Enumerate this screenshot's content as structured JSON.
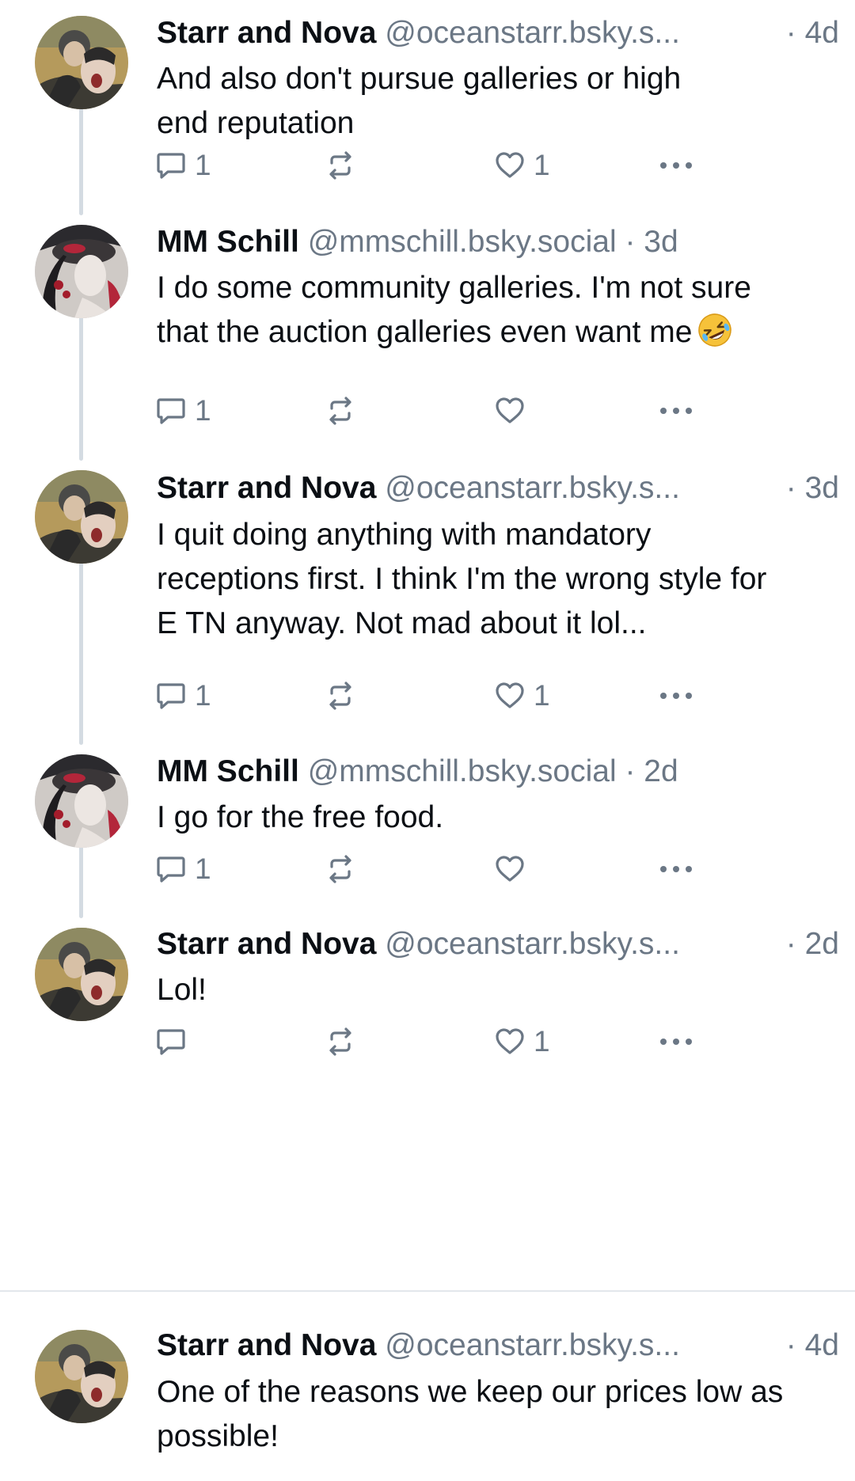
{
  "posts": [
    {
      "name": "Starr and Nova",
      "handle": "@oceanstarr.bsky.s...",
      "time": "· 4d",
      "text": "And also don't pursue galleries or high end reputation",
      "reply_count": "1",
      "like_count": "1",
      "avatar": "starr-nova-avatar"
    },
    {
      "name": "MM Schill",
      "handle": "@mmschill.bsky.social",
      "time": "· 3d",
      "text": "I do some community galleries. I'm not sure that the auction galleries even want me",
      "emoji": "rolling-on-floor-laughing-emoji",
      "reply_count": "1",
      "like_count": "",
      "avatar": "mm-schill-avatar"
    },
    {
      "name": "Starr and Nova",
      "handle": "@oceanstarr.bsky.s...",
      "time": "· 3d",
      "text": "I quit doing anything with mandatory receptions first. I think I'm the wrong style for E TN anyway. Not mad about it lol...",
      "reply_count": "1",
      "like_count": "1",
      "avatar": "starr-nova-avatar"
    },
    {
      "name": "MM Schill",
      "handle": "@mmschill.bsky.social",
      "time": "· 2d",
      "text": "I go for the free food.",
      "reply_count": "1",
      "like_count": "",
      "avatar": "mm-schill-avatar"
    },
    {
      "name": "Starr and Nova",
      "handle": "@oceanstarr.bsky.s...",
      "time": "· 2d",
      "text": "Lol!",
      "reply_count": "",
      "like_count": "1",
      "avatar": "starr-nova-avatar"
    },
    {
      "name": "Starr and Nova",
      "handle": "@oceanstarr.bsky.s...",
      "time": "· 4d",
      "text": "One of the reasons we keep our prices low as possible!",
      "avatar": "starr-nova-avatar"
    }
  ],
  "icons": {
    "reply": "reply-icon",
    "repost": "repost-icon",
    "like": "heart-icon",
    "more": "more-options-icon"
  },
  "colors": {
    "muted": "#6b7785",
    "thread_line": "#d4dbe2",
    "text": "#0b0f14"
  }
}
